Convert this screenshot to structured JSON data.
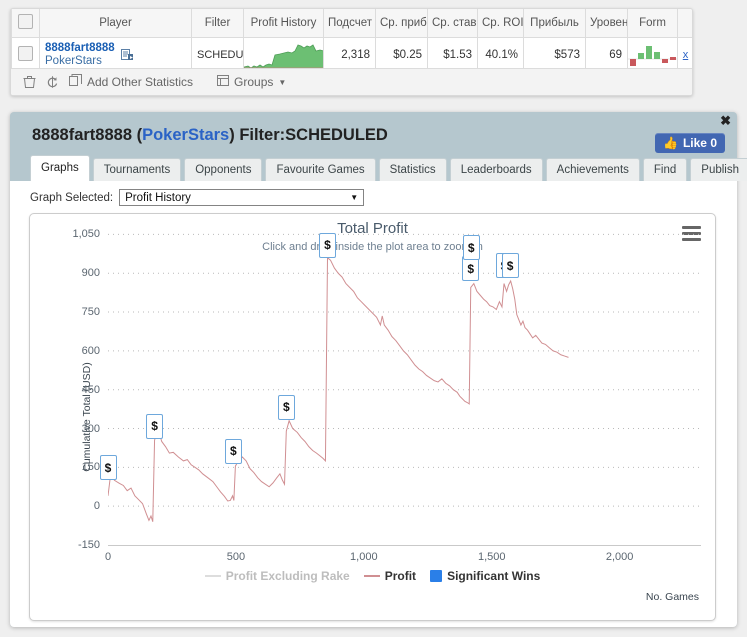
{
  "table": {
    "columns": [
      "Player",
      "Filter",
      "Profit History",
      "Подсчет",
      "Ср. приб",
      "Ср. ставка",
      "Ср. ROI",
      "Прибыль",
      "Уровень",
      "Form"
    ],
    "row": {
      "player_name": "8888fart8888",
      "player_site": "PokerStars",
      "filter": "SCHEDULED",
      "count": "2,318",
      "avg_profit": "$0.25",
      "avg_stake": "$1.53",
      "avg_roi": "40.1%",
      "profit": "$573",
      "level": "69",
      "note_icon": "note-icon",
      "form_icon": "form-chart-icon",
      "sharkscope_icon": "sharkscope-x-icon"
    },
    "toolbar": {
      "delete_icon": "trash-icon",
      "refresh_icon": "refresh-icon",
      "add_icon": "copy-icon",
      "add_label": "Add Other Statistics",
      "groups_icon": "groups-icon",
      "groups_label": "Groups",
      "groups_caret": "▼"
    }
  },
  "panel": {
    "title_player": "8888fart8888",
    "title_open": " (",
    "title_site": "PokerStars",
    "title_close": ") Filter:SCHEDULED",
    "close_label": "✖",
    "like": {
      "icon": "thumbs-up-icon",
      "label": "Like 0"
    },
    "tabs": [
      {
        "label": "Graphs",
        "active": true
      },
      {
        "label": "Tournaments",
        "active": false
      },
      {
        "label": "Opponents",
        "active": false
      },
      {
        "label": "Favourite Games",
        "active": false
      },
      {
        "label": "Statistics",
        "active": false
      },
      {
        "label": "Leaderboards",
        "active": false
      },
      {
        "label": "Achievements",
        "active": false
      },
      {
        "label": "Find",
        "active": false
      },
      {
        "label": "Publish",
        "active": false
      }
    ],
    "graph_select": {
      "label": "Graph Selected:",
      "value": "Profit History",
      "caret": "▼",
      "options": [
        "Profit History"
      ]
    },
    "menu_icon": "hamburger-menu-icon"
  },
  "colors": {
    "panel_header": "#b5c7ce",
    "profit_line": "#d08f92",
    "profit_ex_rake": "#dddddd",
    "significant_wins": "#2a7fe8",
    "marker_border": "#6ea8dc",
    "link": "#2b63c6",
    "facebook_blue": "#4267b2"
  },
  "chart_data": {
    "type": "line",
    "title": "Total Profit",
    "subtitle": "Click and drag inside the plot area to zoom-in",
    "xlabel": "No. Games",
    "ylabel": "Cumulative Total (USD)",
    "xlim": [
      0,
      2318
    ],
    "ylim": [
      -150,
      1125
    ],
    "yticks": [
      1050,
      900,
      750,
      600,
      450,
      300,
      150,
      0,
      -150
    ],
    "ytick_labels": [
      "1,050",
      "900",
      "750",
      "600",
      "450",
      "300",
      "150",
      "0",
      "-150"
    ],
    "xticks": [
      0,
      500,
      1000,
      1500,
      2000
    ],
    "xtick_labels": [
      "0",
      "500",
      "1,000",
      "1,500",
      "2,000"
    ],
    "grid": true,
    "legend_position": "bottom",
    "legend": [
      {
        "name": "Profit Excluding Rake",
        "marker": "line",
        "color": "#dddddd",
        "disabled": true
      },
      {
        "name": "Profit",
        "marker": "line",
        "color": "#d08f92",
        "disabled": false
      },
      {
        "name": "Significant Wins",
        "marker": "square",
        "color": "#2a7fe8",
        "disabled": false
      }
    ],
    "series": [
      {
        "name": "Profit",
        "color": "#d08f92",
        "points": [
          [
            0,
            40
          ],
          [
            10,
            120
          ],
          [
            25,
            100
          ],
          [
            45,
            88
          ],
          [
            60,
            80
          ],
          [
            75,
            60
          ],
          [
            90,
            70
          ],
          [
            105,
            40
          ],
          [
            120,
            25
          ],
          [
            135,
            10
          ],
          [
            150,
            -30
          ],
          [
            160,
            -55
          ],
          [
            168,
            -38
          ],
          [
            175,
            -60
          ],
          [
            182,
            255
          ],
          [
            195,
            300
          ],
          [
            210,
            250
          ],
          [
            225,
            230
          ],
          [
            240,
            205
          ],
          [
            255,
            208
          ],
          [
            275,
            190
          ],
          [
            295,
            175
          ],
          [
            310,
            180
          ],
          [
            325,
            160
          ],
          [
            340,
            150
          ],
          [
            355,
            140
          ],
          [
            370,
            125
          ],
          [
            390,
            110
          ],
          [
            410,
            95
          ],
          [
            425,
            75
          ],
          [
            440,
            55
          ],
          [
            455,
            38
          ],
          [
            468,
            20
          ],
          [
            478,
            22
          ],
          [
            487,
            40
          ],
          [
            492,
            22
          ],
          [
            498,
            155
          ],
          [
            510,
            175
          ],
          [
            525,
            190
          ],
          [
            540,
            175
          ],
          [
            555,
            145
          ],
          [
            570,
            130
          ],
          [
            585,
            110
          ],
          [
            600,
            95
          ],
          [
            615,
            85
          ],
          [
            630,
            75
          ],
          [
            645,
            90
          ],
          [
            660,
            110
          ],
          [
            672,
            125
          ],
          [
            682,
            100
          ],
          [
            690,
            85
          ],
          [
            697,
            290
          ],
          [
            708,
            330
          ],
          [
            722,
            300
          ],
          [
            740,
            285
          ],
          [
            755,
            265
          ],
          [
            770,
            250
          ],
          [
            785,
            230
          ],
          [
            800,
            215
          ],
          [
            815,
            205
          ],
          [
            828,
            195
          ],
          [
            840,
            185
          ],
          [
            850,
            175
          ],
          [
            858,
            960
          ],
          [
            870,
            950
          ],
          [
            885,
            920
          ],
          [
            900,
            900
          ],
          [
            915,
            885
          ],
          [
            930,
            860
          ],
          [
            945,
            845
          ],
          [
            960,
            830
          ],
          [
            975,
            805
          ],
          [
            990,
            790
          ],
          [
            1005,
            775
          ],
          [
            1020,
            760
          ],
          [
            1035,
            745
          ],
          [
            1050,
            730
          ],
          [
            1065,
            700
          ],
          [
            1072,
            735
          ],
          [
            1080,
            700
          ],
          [
            1095,
            680
          ],
          [
            1110,
            655
          ],
          [
            1125,
            640
          ],
          [
            1140,
            620
          ],
          [
            1155,
            600
          ],
          [
            1170,
            585
          ],
          [
            1185,
            565
          ],
          [
            1200,
            545
          ],
          [
            1215,
            530
          ],
          [
            1230,
            520
          ],
          [
            1245,
            505
          ],
          [
            1260,
            495
          ],
          [
            1275,
            485
          ],
          [
            1290,
            480
          ],
          [
            1305,
            492
          ],
          [
            1320,
            475
          ],
          [
            1335,
            465
          ],
          [
            1350,
            450
          ],
          [
            1365,
            440
          ],
          [
            1375,
            425
          ],
          [
            1385,
            415
          ],
          [
            1395,
            405
          ],
          [
            1405,
            400
          ],
          [
            1412,
            395
          ],
          [
            1418,
            845
          ],
          [
            1430,
            860
          ],
          [
            1442,
            830
          ],
          [
            1455,
            815
          ],
          [
            1468,
            800
          ],
          [
            1480,
            790
          ],
          [
            1492,
            775
          ],
          [
            1505,
            770
          ],
          [
            1518,
            760
          ],
          [
            1530,
            790
          ],
          [
            1540,
            770
          ],
          [
            1548,
            860
          ],
          [
            1558,
            830
          ],
          [
            1566,
            855
          ],
          [
            1574,
            870
          ],
          [
            1582,
            840
          ],
          [
            1590,
            800
          ],
          [
            1598,
            740
          ],
          [
            1606,
            720
          ],
          [
            1614,
            700
          ],
          [
            1622,
            715
          ],
          [
            1630,
            690
          ],
          [
            1640,
            680
          ],
          [
            1650,
            665
          ],
          [
            1660,
            650
          ],
          [
            1672,
            660
          ],
          [
            1684,
            645
          ],
          [
            1696,
            630
          ],
          [
            1710,
            625
          ],
          [
            1725,
            612
          ],
          [
            1740,
            600
          ],
          [
            1755,
            595
          ],
          [
            1770,
            585
          ],
          [
            1785,
            580
          ],
          [
            1800,
            575
          ]
        ]
      }
    ],
    "significant_wins": [
      {
        "x": 0,
        "y": 150,
        "label": "$"
      },
      {
        "x": 182,
        "y": 310,
        "label": "$"
      },
      {
        "x": 490,
        "y": 215,
        "label": "$"
      },
      {
        "x": 697,
        "y": 385,
        "label": "$"
      },
      {
        "x": 858,
        "y": 1010,
        "label": "$"
      },
      {
        "x": 1418,
        "y": 920,
        "label": "$"
      },
      {
        "x": 1420,
        "y": 1000,
        "label": "$"
      },
      {
        "x": 1548,
        "y": 930,
        "label": "$"
      },
      {
        "x": 1572,
        "y": 930,
        "label": "$"
      }
    ]
  }
}
